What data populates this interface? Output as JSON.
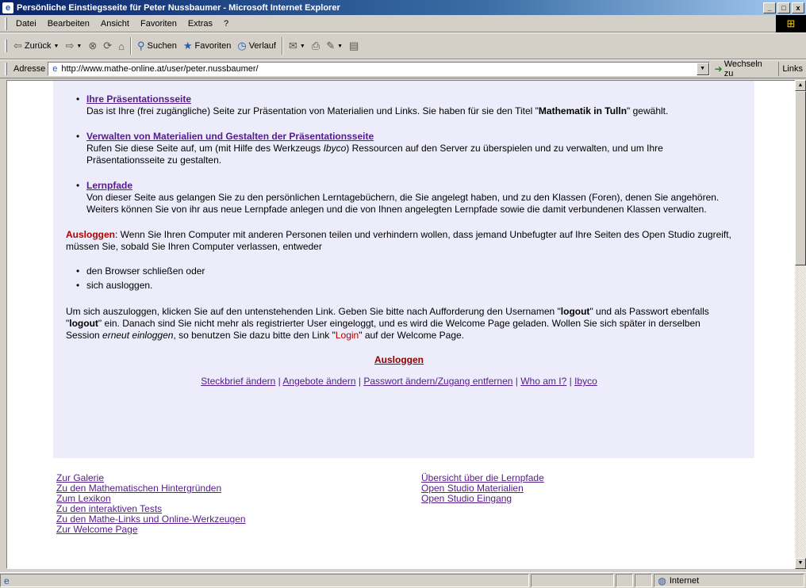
{
  "window": {
    "title": "Persönliche Einstiegsseite für Peter Nussbaumer - Microsoft Internet Explorer",
    "controls": [
      "_",
      "□",
      "x"
    ]
  },
  "menu": [
    {
      "label": "Datei"
    },
    {
      "label": "Bearbeiten"
    },
    {
      "label": "Ansicht"
    },
    {
      "label": "Favoriten"
    },
    {
      "label": "Extras"
    },
    {
      "label": "?"
    }
  ],
  "toolbar": {
    "back": "Zurück",
    "search": "Suchen",
    "favorites": "Favoriten",
    "history": "Verlauf"
  },
  "address": {
    "label": "Adresse",
    "url": "http://www.mathe-online.at/user/peter.nussbaumer/",
    "go": "Wechseln zu",
    "links": "Links"
  },
  "content": {
    "sections": [
      {
        "link": "Ihre Präsentationsseite",
        "text_before": "Das ist Ihre (frei zugängliche) Seite zur Präsentation von Materialien und Links. Sie haben für sie den Titel \"",
        "bold": "Mathematik in Tulln",
        "text_after": "\" gewählt."
      },
      {
        "link": "Verwalten von Materialien und Gestalten der Präsentationsseite",
        "text_before": "Rufen Sie diese Seite auf, um (mit Hilfe des Werkzeugs ",
        "italic": "Ibyco",
        "text_after": ") Ressourcen auf den Server zu überspielen und zu verwalten, und um Ihre Präsentationsseite zu gestalten."
      },
      {
        "link": "Lernpfade",
        "text": "Von dieser Seite aus gelangen Sie zu den persönlichen Lerntagebüchern, die Sie angelegt haben, und zu den Klassen (Foren), denen Sie angehören. Weiters können Sie von ihr aus neue Lernpfade anlegen und die von Ihnen angelegten Lernpfade sowie die damit verbundenen Klassen verwalten."
      }
    ],
    "logout_intro": {
      "label": "Ausloggen",
      "text": ": Wenn Sie Ihren Computer mit anderen Personen teilen und verhindern wollen, dass jemand Unbefugter auf Ihre Seiten des Open Studio zugreift, müssen Sie, sobald Sie Ihren Computer verlassen, entweder"
    },
    "options": [
      "den Browser schließen oder",
      "sich ausloggen."
    ],
    "instructions": {
      "t1": "Um sich auszuloggen, klicken Sie auf den untenstehenden Link. Geben Sie bitte nach Aufforderung den Usernamen \"",
      "b1": "logout",
      "t2": "\" und als Passwort ebenfalls \"",
      "b2": "logout",
      "t3": "\" ein. Danach sind Sie nicht mehr als registrierter User eingeloggt, und es wird die Welcome Page geladen. Wollen Sie sich später in derselben Session ",
      "i1": "erneut einloggen",
      "t4": ", so benutzen Sie dazu bitte den Link \"",
      "login": "Login",
      "t5": "\" auf der Welcome Page."
    },
    "logout_link": "Ausloggen",
    "bottom_links": [
      "Steckbrief ändern",
      "Angebote ändern",
      "Passwort ändern/Zugang entfernen",
      "Who am I?",
      "Ibyco"
    ],
    "bottom_sep": " | "
  },
  "footer": {
    "left": [
      "Zur Galerie",
      "Zu den Mathematischen Hintergründen",
      "Zum Lexikon",
      "Zu den interaktiven Tests",
      "Zu den Mathe-Links und Online-Werkzeugen",
      "Zur Welcome Page"
    ],
    "right": [
      "Übersicht über die Lernpfade",
      "Open Studio Materialien",
      "Open Studio Eingang"
    ]
  },
  "status": {
    "zone": "Internet"
  }
}
